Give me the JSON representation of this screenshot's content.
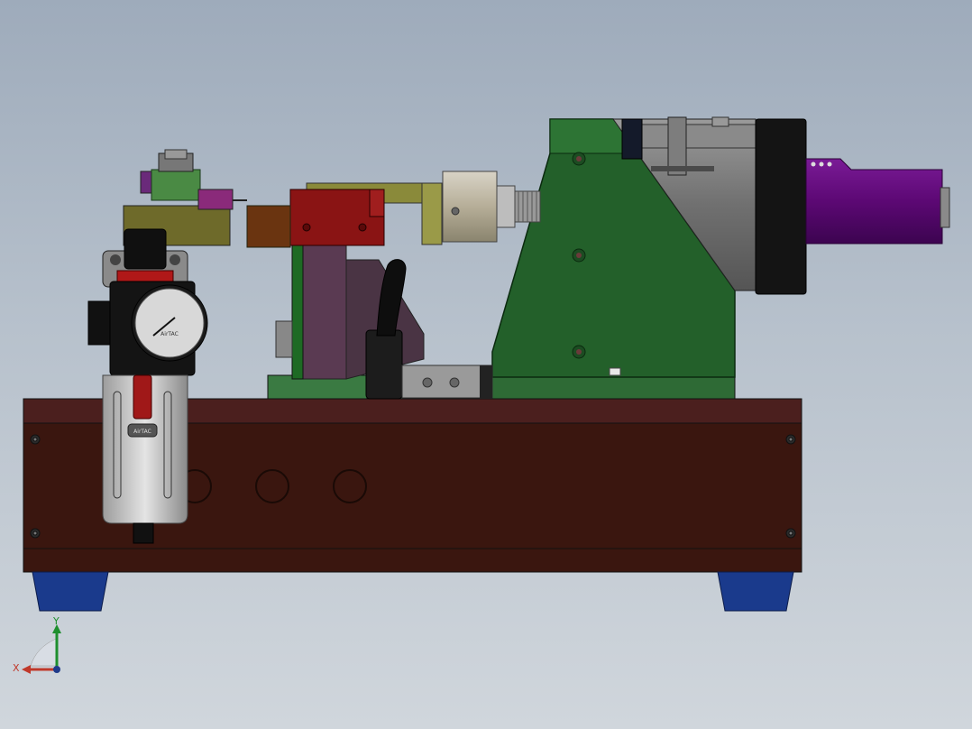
{
  "viewport": {
    "background_top": "#9eabbb",
    "background_bottom": "#d0d6dc"
  },
  "model": {
    "regulator_brand": "AirTAC"
  },
  "triad": {
    "x_label": "X",
    "y_label": "Y",
    "x_color": "#c0392b",
    "y_color": "#1e8f2e",
    "z_color": "#1e3a8a"
  },
  "colors": {
    "base_frame": "#3a160f",
    "base_top": "#4b1f1e",
    "feet": "#1a3a8c",
    "green_bracket": "#23602a",
    "purple_motor": "#6a0a84",
    "red_block": "#8a1414",
    "olive_arm": "#8a8a3a",
    "regulator_body": "#c8c8c8"
  }
}
